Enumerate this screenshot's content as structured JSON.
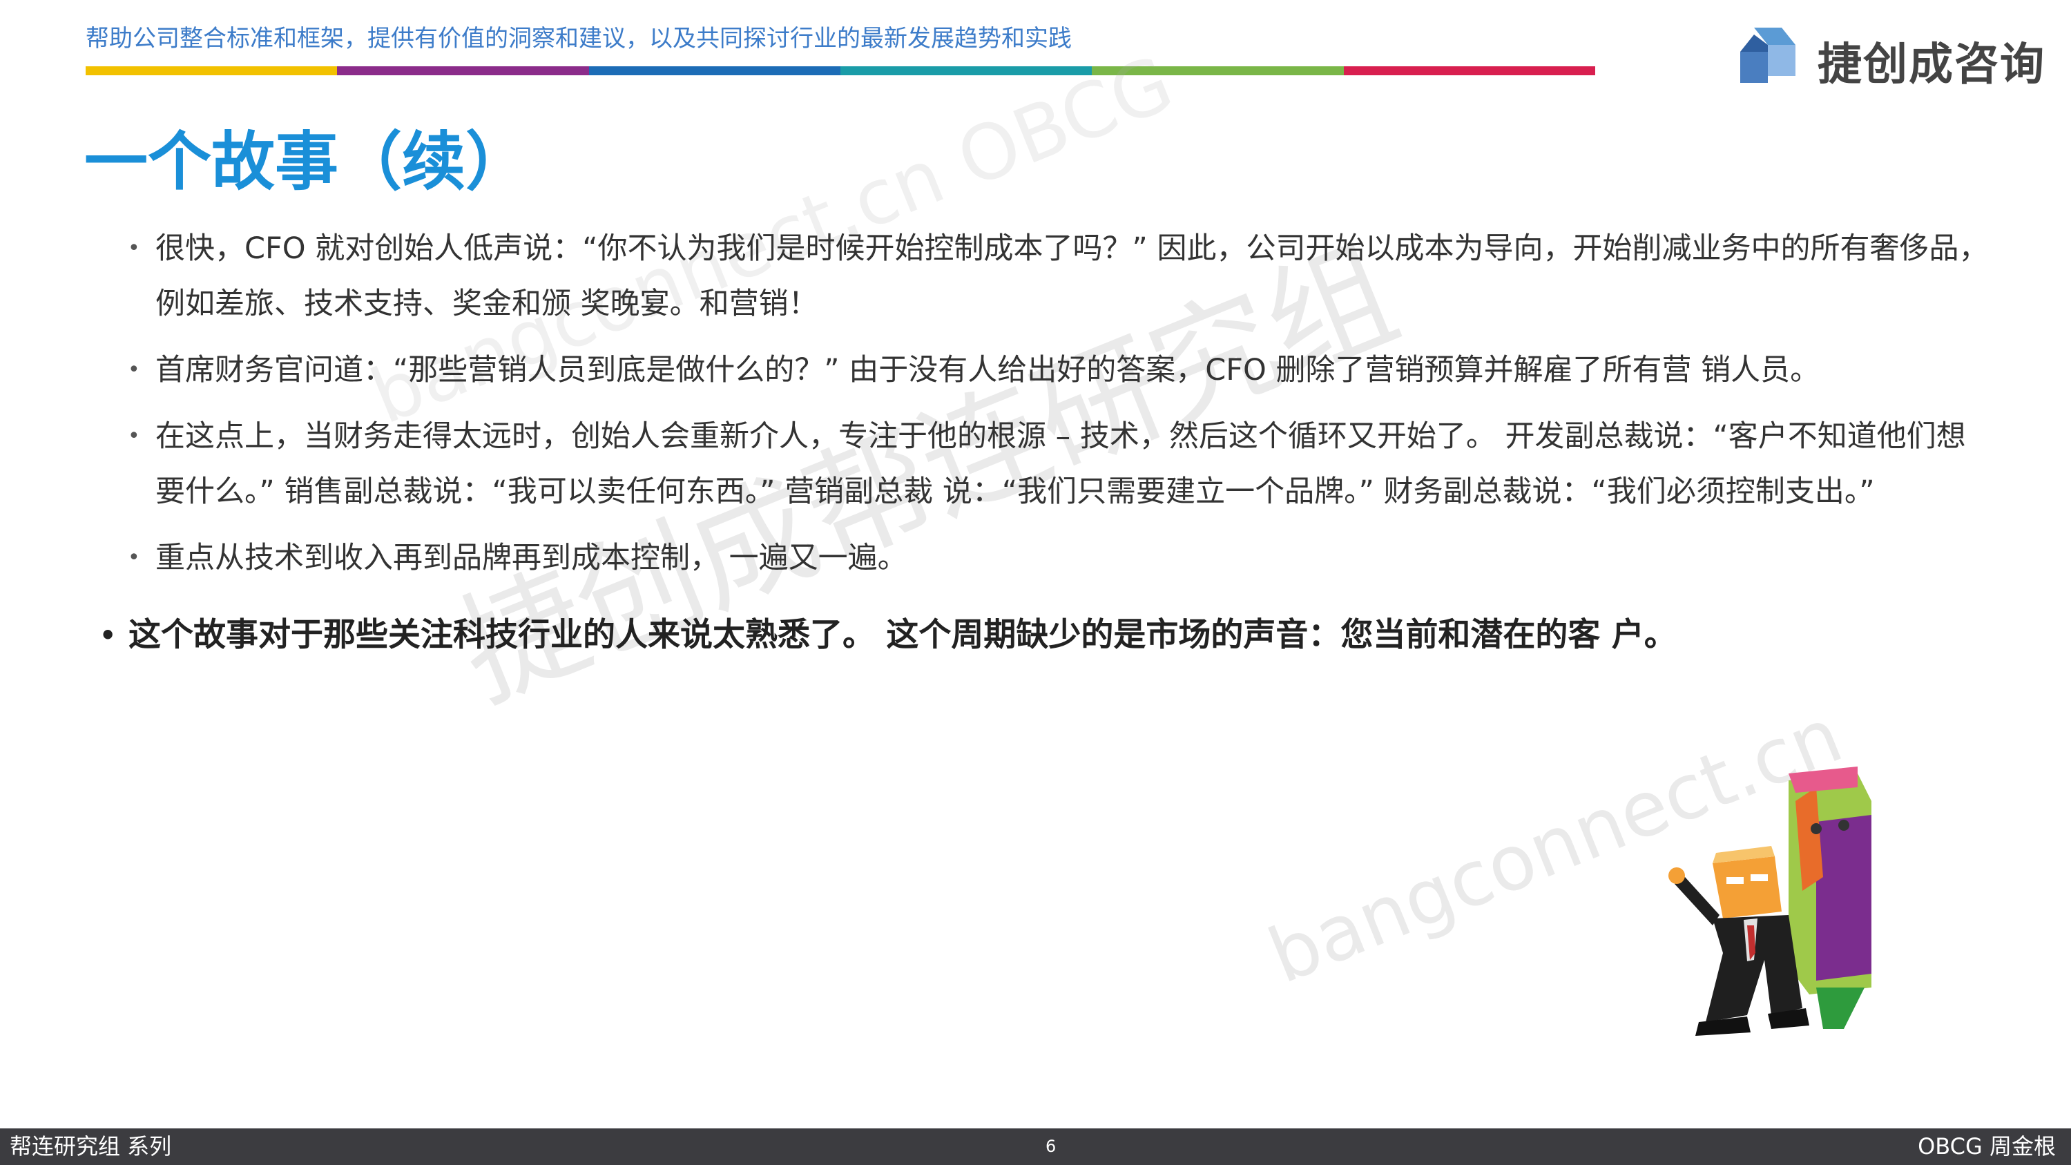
{
  "header": {
    "tagline": "帮助公司整合标准和框架，提供有价值的洞察和建议，以及共同探讨行业的最新发展趋势和实践",
    "color_bar": [
      "#f2c100",
      "#8b2c8a",
      "#1c6cb6",
      "#1a9ca8",
      "#7ab648",
      "#d81f4f"
    ],
    "logo_text": "捷创成咨询"
  },
  "page_title": "一个故事（续）",
  "bullets": [
    "很快，CFO 就对创始人低声说：“你不认为我们是时候开始控制成本了吗？” 因此，公司开始以成本为导向，开始削减业务中的所有奢侈品，例如差旅、技术支持、奖金和颁 奖晚宴。和营销！",
    "首席财务官问道：“那些营销人员到底是做什么的？” 由于没有人给出好的答案，CFO 删除了营销预算并解雇了所有营 销人员。",
    "在这点上，当财务走得太远时，创始人会重新介人，专注于他的根源 – 技术，然后这个循环又开始了。 开发副总裁说：“客户不知道他们想要什么。” 销售副总裁说：“我可以卖任何东西。” 营销副总裁 说：“我们只需要建立一个品牌。” 财务副总裁说：“我们必须控制支出。”",
    "重点从技术到收入再到品牌再到成本控制， 一遍又一遍。"
  ],
  "main_point": "这个故事对于那些关注科技行业的人来说太熟悉了。 这个周期缺少的是市场的声音：您当前和潜在的客 户。",
  "watermarks": {
    "cn": "捷创成帮连研究组",
    "en": "bangconnect.cn",
    "en2": "bangconnect.cn OBCG"
  },
  "footer": {
    "left": "帮连研究组 系列",
    "page": "6",
    "right": "OBCG 周金根"
  }
}
